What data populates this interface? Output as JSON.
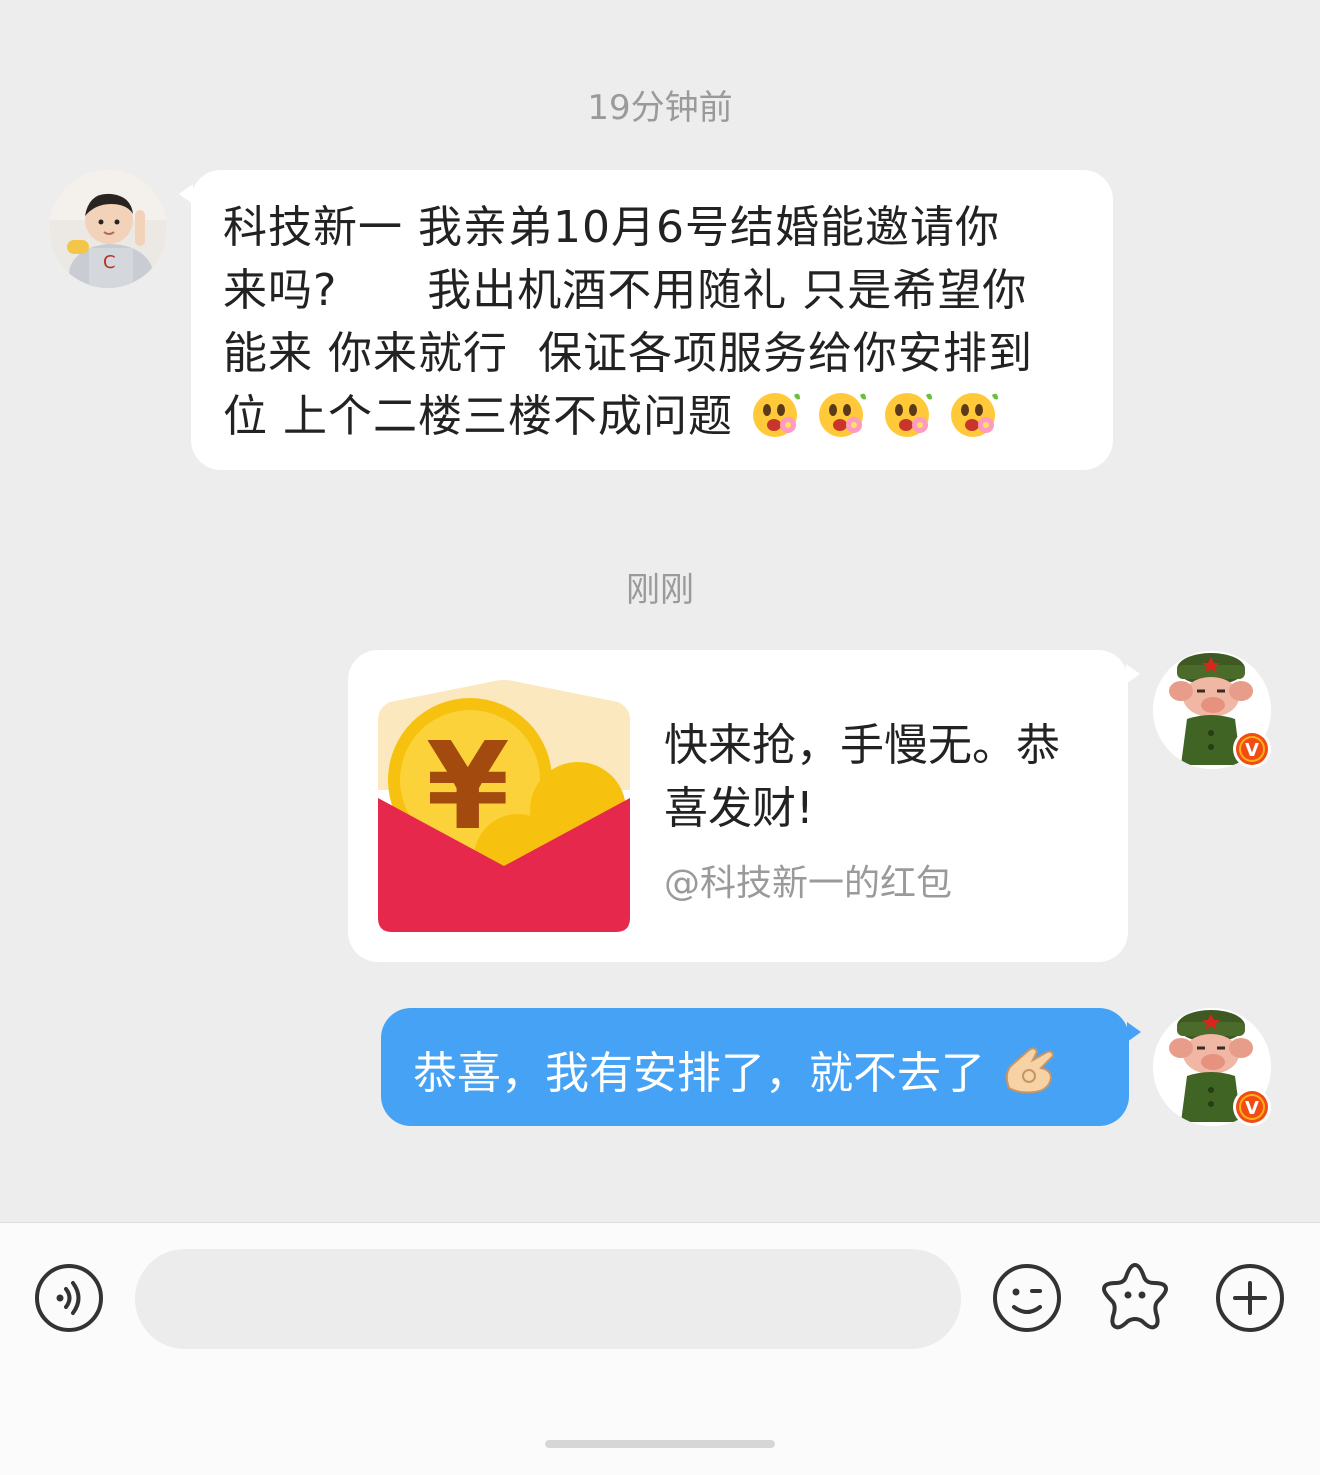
{
  "chat": {
    "timestamp_1": "19分钟前",
    "timestamp_2": "刚刚",
    "incoming_message": {
      "lines": [
        "科技新一 我亲弟10月6号结婚能邀请你",
        "来吗?      我出机酒不用随礼 只是希望你",
        "能来 你来就行  保证各项服务给你安排到",
        "位 上个二楼三楼不成问题"
      ],
      "emoji": "flower-face-emoji",
      "emoji_count": 4
    },
    "red_packet": {
      "title_line_1": "快来抢，手慢无。恭",
      "title_line_2": "喜发财!",
      "source": "@科技新一的红包",
      "colors": {
        "envelope": "#e5284b",
        "coin": "#f7c20f",
        "symbol": "#a34a0f"
      }
    },
    "outgoing_message": {
      "text": "恭喜，我有安排了，就不去了",
      "emoji": "ok-hand-emoji"
    },
    "verified_badge": "V"
  },
  "input_bar": {
    "voice_icon": "voice-icon",
    "emoji_icon": "smiley-icon",
    "sticker_icon": "star-face-icon",
    "plus_icon": "plus-icon"
  },
  "colors": {
    "background": "#ededed",
    "bubble": "#ffffff",
    "outgoing_bubble": "#45a2f5",
    "timestamp": "#9a9a9a",
    "badge": "#f24c12"
  }
}
